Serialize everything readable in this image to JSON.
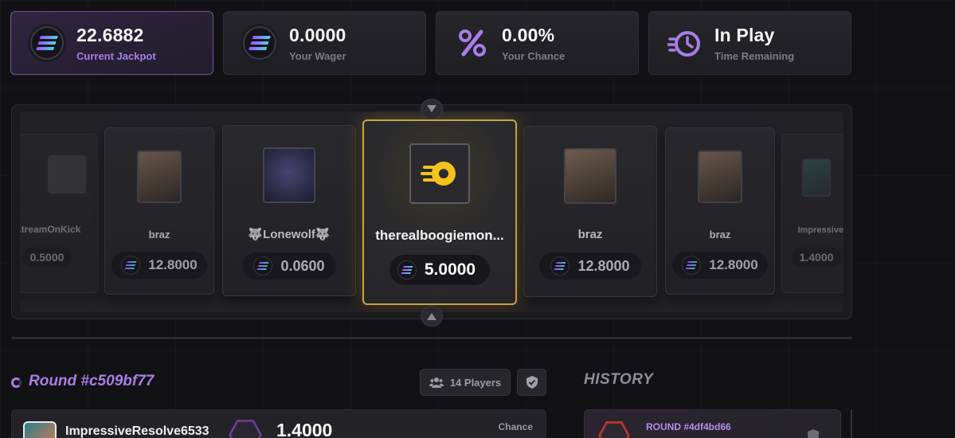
{
  "stats": [
    {
      "value": "22.6882",
      "label": "Current Jackpot",
      "icon": "solana-coin-icon",
      "active": true
    },
    {
      "value": "0.0000",
      "label": "Your Wager",
      "icon": "solana-coin-icon"
    },
    {
      "value": "0.00%",
      "label": "Your Chance",
      "icon": "percent-icon"
    },
    {
      "value": "In Play",
      "label": "Time Remaining",
      "icon": "timer-icon"
    }
  ],
  "spinner": {
    "cards": [
      {
        "name": "...treamOnKick",
        "amount": "0.5000"
      },
      {
        "name": "braz",
        "amount": "12.8000"
      },
      {
        "name": "🐺Lonewolf🐺",
        "amount": "0.0600"
      },
      {
        "name": "therealboogiemon...",
        "amount": "5.0000",
        "winner": true
      },
      {
        "name": "braz",
        "amount": "12.8000"
      },
      {
        "name": "braz",
        "amount": "12.8000"
      },
      {
        "name": "ImpressiveRes...",
        "amount": "1.4000"
      }
    ]
  },
  "round": {
    "title": "Round #c509bf77",
    "players_label": "14 Players"
  },
  "entry": {
    "name": "ImpressiveResolve6533",
    "amount": "1.4000",
    "chance_label": "Chance"
  },
  "history": {
    "title": "HISTORY",
    "round_label": "ROUND #4df4bd66"
  },
  "colors": {
    "accent": "#a97de6",
    "gold": "#c9a24a",
    "background": "#121214"
  }
}
